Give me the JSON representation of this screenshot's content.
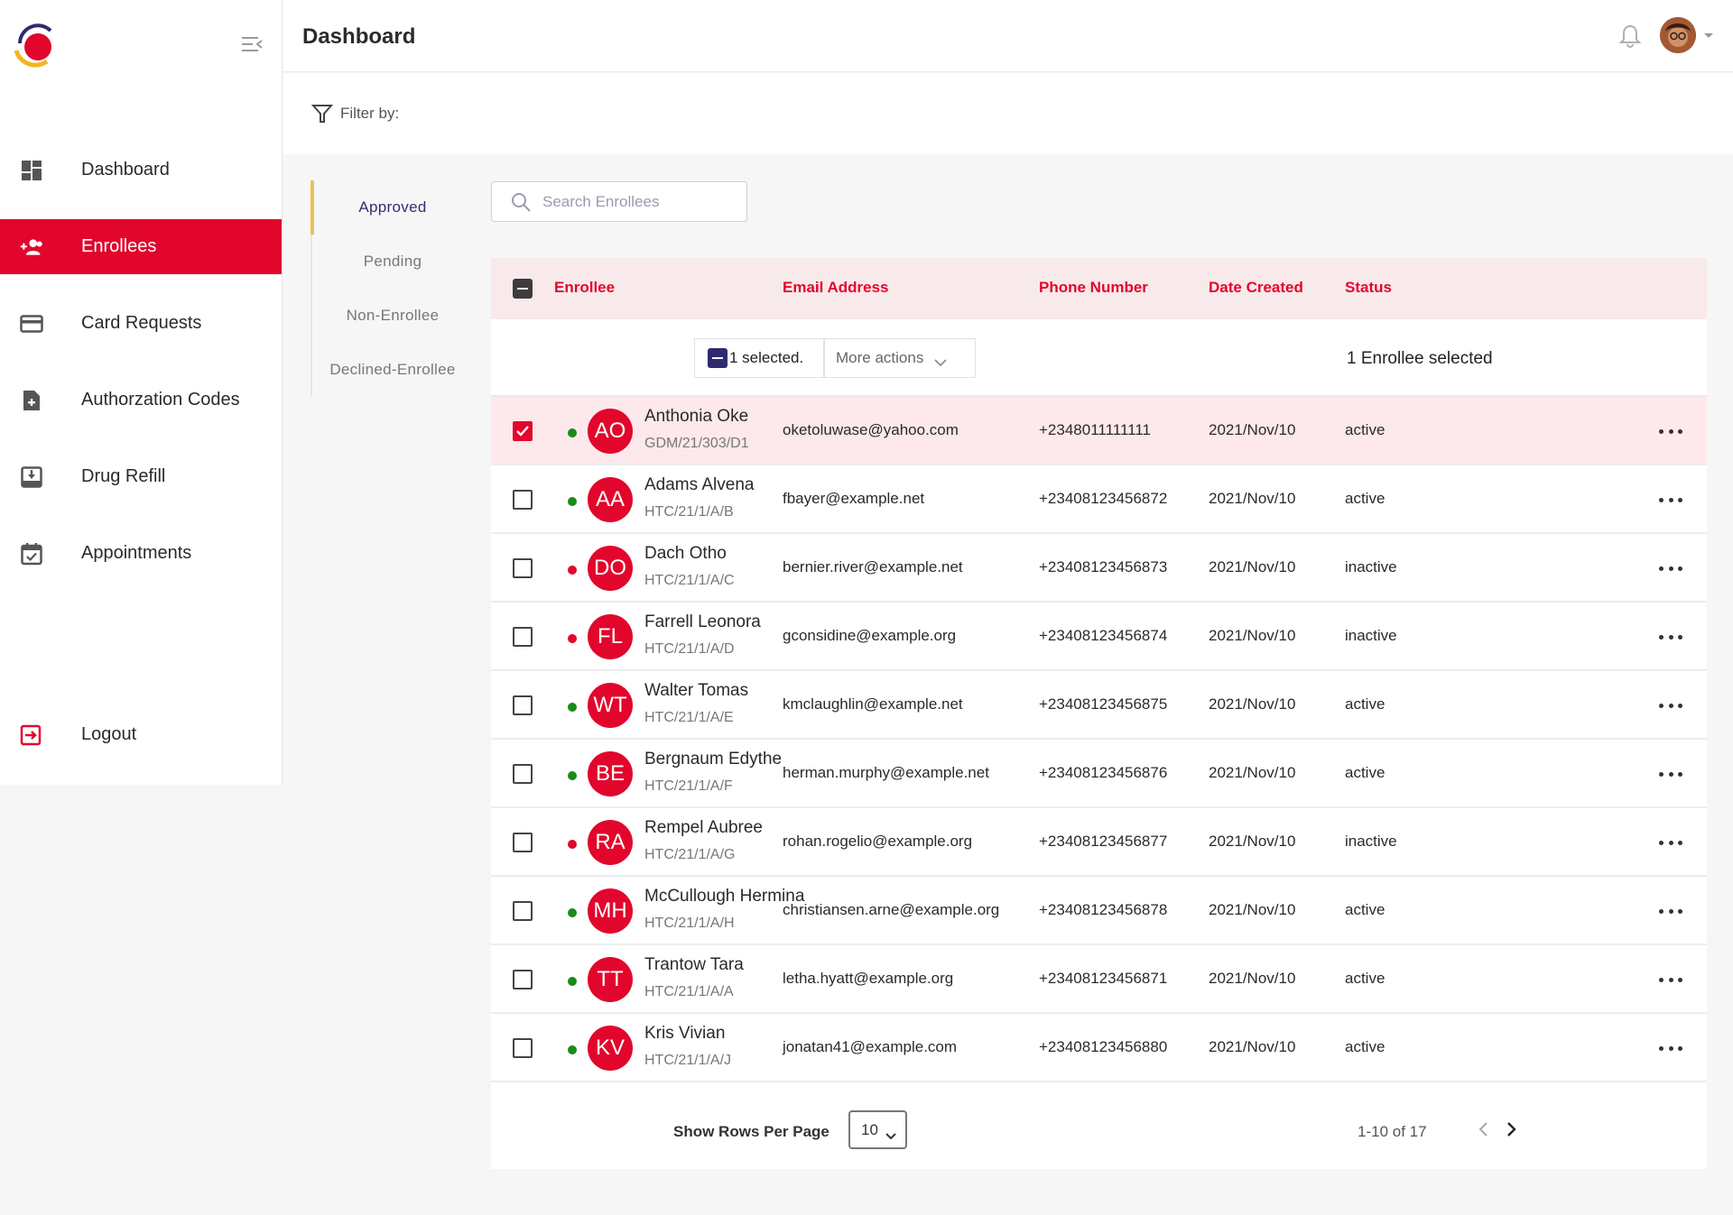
{
  "colors": {
    "brand": "#e2062c",
    "active_dot": "#1a8a1a",
    "inactive_dot": "#e2062c",
    "tab_indicator": "#f2c14e"
  },
  "sidebar": {
    "items": [
      {
        "label": "Dashboard",
        "icon": "dashboard-icon"
      },
      {
        "label": "Enrollees",
        "icon": "add-user-icon",
        "active": true
      },
      {
        "label": "Card Requests",
        "icon": "credit-card-icon"
      },
      {
        "label": "Authorzation Codes",
        "icon": "document-add-icon"
      },
      {
        "label": "Drug Refill",
        "icon": "download-box-icon"
      },
      {
        "label": "Appointments",
        "icon": "calendar-check-icon"
      }
    ],
    "logout": "Logout"
  },
  "header": {
    "title": "Dashboard"
  },
  "filter": {
    "label": "Filter by:"
  },
  "subtabs": [
    "Approved",
    "Pending",
    "Non-Enrollee",
    "Declined-Enrollee"
  ],
  "search": {
    "placeholder": "Search Enrollees"
  },
  "table": {
    "headers": {
      "enrollee": "Enrollee",
      "email": "Email Address",
      "phone": "Phone Number",
      "date": "Date Created",
      "status": "Status"
    },
    "selection": {
      "count_label": "1 selected.",
      "more_actions": "More actions",
      "summary": "1 Enrollee selected"
    },
    "rows": [
      {
        "initials": "AO",
        "name": "Anthonia Oke",
        "code": "GDM/21/303/D1",
        "email": "oketoluwase@yahoo.com",
        "phone": "+2348011111111",
        "date": "2021/Nov/10",
        "status": "active",
        "selected": true
      },
      {
        "initials": "AA",
        "name": "Adams Alvena",
        "code": "HTC/21/1/A/B",
        "email": "fbayer@example.net",
        "phone": "+23408123456872",
        "date": "2021/Nov/10",
        "status": "active"
      },
      {
        "initials": "DO",
        "name": "Dach Otho",
        "code": "HTC/21/1/A/C",
        "email": "bernier.river@example.net",
        "phone": "+23408123456873",
        "date": "2021/Nov/10",
        "status": "inactive"
      },
      {
        "initials": "FL",
        "name": "Farrell Leonora",
        "code": "HTC/21/1/A/D",
        "email": "gconsidine@example.org",
        "phone": "+23408123456874",
        "date": "2021/Nov/10",
        "status": "inactive"
      },
      {
        "initials": "WT",
        "name": "Walter Tomas",
        "code": "HTC/21/1/A/E",
        "email": "kmclaughlin@example.net",
        "phone": "+23408123456875",
        "date": "2021/Nov/10",
        "status": "active"
      },
      {
        "initials": "BE",
        "name": "Bergnaum Edythe",
        "code": "HTC/21/1/A/F",
        "email": "herman.murphy@example.net",
        "phone": "+23408123456876",
        "date": "2021/Nov/10",
        "status": "active"
      },
      {
        "initials": "RA",
        "name": "Rempel Aubree",
        "code": "HTC/21/1/A/G",
        "email": "rohan.rogelio@example.org",
        "phone": "+23408123456877",
        "date": "2021/Nov/10",
        "status": "inactive"
      },
      {
        "initials": "MH",
        "name": "McCullough Hermina",
        "code": "HTC/21/1/A/H",
        "email": "christiansen.arne@example.org",
        "phone": "+23408123456878",
        "date": "2021/Nov/10",
        "status": "active"
      },
      {
        "initials": "TT",
        "name": "Trantow Tara",
        "code": "HTC/21/1/A/A",
        "email": "letha.hyatt@example.org",
        "phone": "+23408123456871",
        "date": "2021/Nov/10",
        "status": "active"
      },
      {
        "initials": "KV",
        "name": "Kris Vivian",
        "code": "HTC/21/1/A/J",
        "email": "jonatan41@example.com",
        "phone": "+23408123456880",
        "date": "2021/Nov/10",
        "status": "active"
      }
    ]
  },
  "pagination": {
    "rows_per_page_label": "Show Rows Per Page",
    "rows_per_page": "10",
    "range": "1-10 of 17"
  }
}
